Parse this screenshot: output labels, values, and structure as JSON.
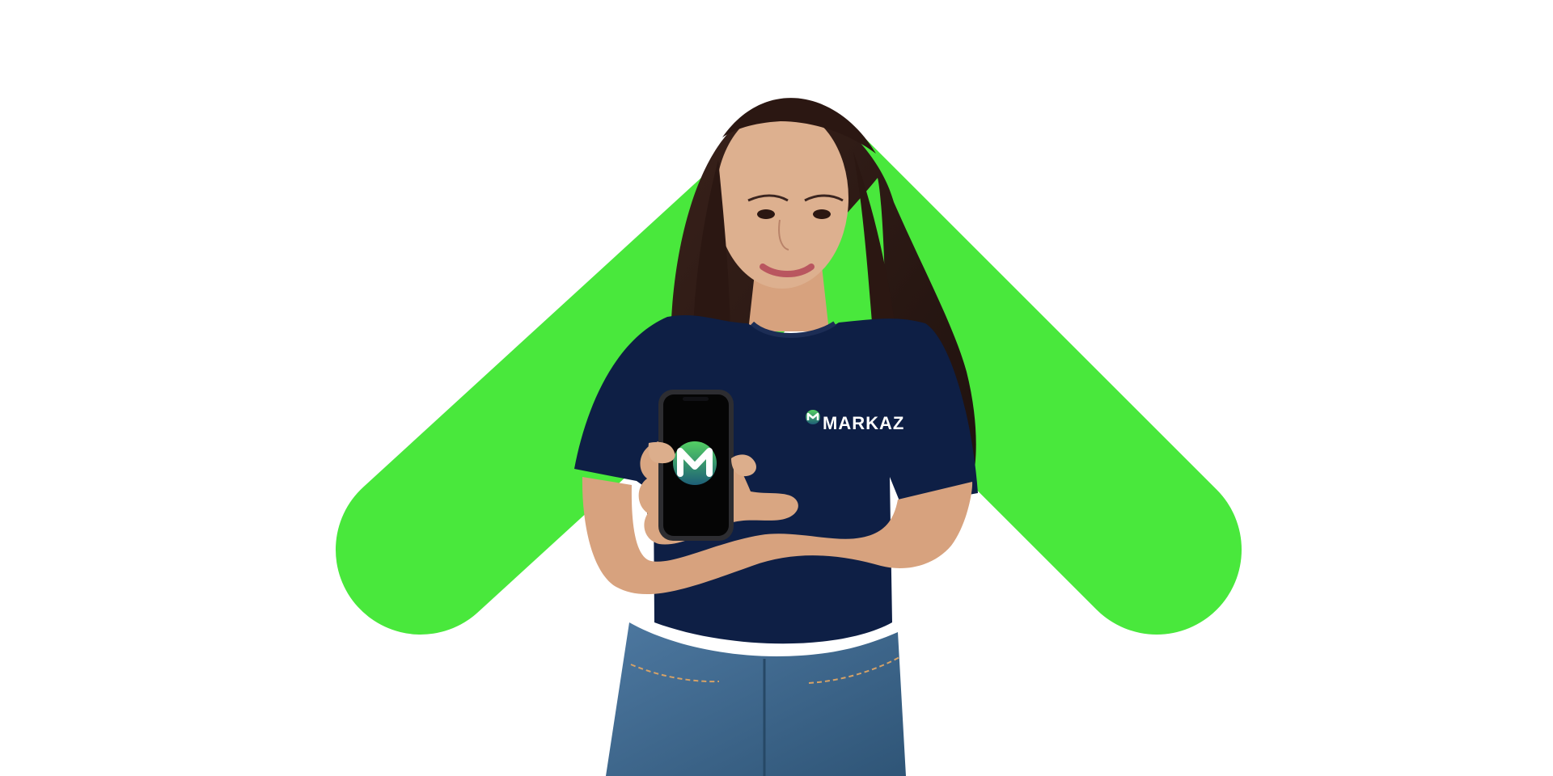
{
  "hero": {
    "brand_text": "MARKAZ",
    "brand_logo_icon": "markaz-m-logo-icon",
    "colors": {
      "background": "#ffffff",
      "accent_green": "#49e83c",
      "shirt_navy": "#0e1f45",
      "jeans_blue": "#3f6990",
      "phone_screen": "#050505",
      "logo_green": "#4fc36b",
      "logo_teal": "#1f5f73",
      "skin": "#d7a27e",
      "hair": "#2b1712"
    }
  }
}
